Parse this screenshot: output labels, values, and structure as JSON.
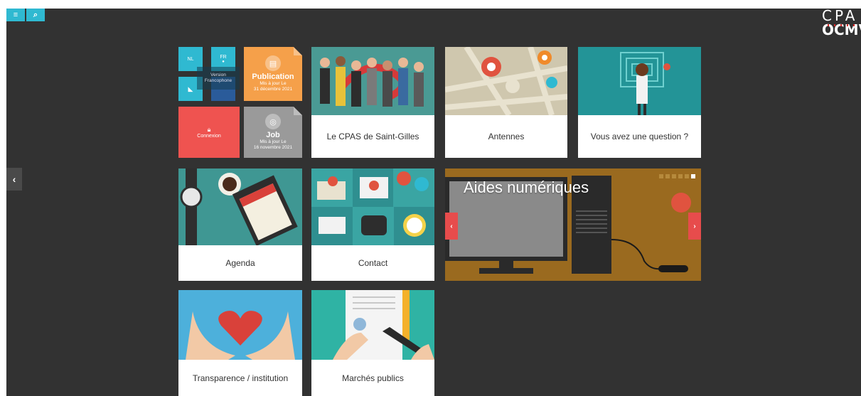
{
  "topbar": {
    "menu_icon": "≡",
    "search_icon": "⌕"
  },
  "brand": {
    "line1": "CPA",
    "line2": "OCMV"
  },
  "sidebar_toggle": "‹",
  "mini_tiles": {
    "nl": "NL",
    "fr": "FR",
    "version_note": "Version Francophone",
    "rss_icon": "rss-icon",
    "connexion": "Connexion"
  },
  "publication": {
    "title": "Publication",
    "date_label": "Mis à jour Le",
    "date": "31 décembre 2021"
  },
  "job": {
    "title": "Job",
    "date_label": "Mis à jour Le",
    "date": "16 novembre 2021"
  },
  "tiles": {
    "cpas": "Le CPAS de Saint-Gilles",
    "antennes": "Antennes",
    "question": "Vous avez une question ?",
    "agenda": "Agenda",
    "contact": "Contact",
    "transparence": "Transparence / institution",
    "marches": "Marchés publics"
  },
  "slider": {
    "title": "Aides numériques",
    "prev": "‹",
    "next": "›",
    "pages": 6,
    "active_page": 6
  },
  "colors": {
    "background": "#323232",
    "cyan": "#2fb9d1",
    "orange": "#f5a04a",
    "red": "#ef5350",
    "grey": "#9a9a9a",
    "slider_bg": "#9a6a1f"
  }
}
